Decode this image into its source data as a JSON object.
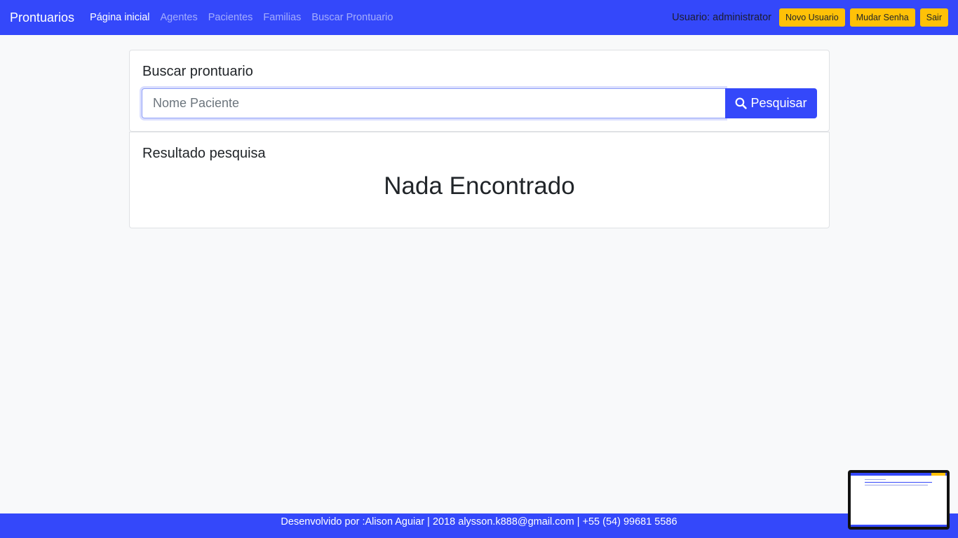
{
  "navbar": {
    "brand": "Prontuarios",
    "links": [
      {
        "label": "Página inicial",
        "active": true
      },
      {
        "label": "Agentes",
        "active": false
      },
      {
        "label": "Pacientes",
        "active": false
      },
      {
        "label": "Familias",
        "active": false
      },
      {
        "label": "Buscar Prontuario",
        "active": false
      }
    ],
    "user_label": "Usuario: administrator",
    "buttons": {
      "new_user": "Novo Usuario",
      "change_password": "Mudar Senha",
      "logout": "Sair"
    }
  },
  "search": {
    "title": "Buscar prontuario",
    "placeholder": "Nome Paciente",
    "value": "",
    "button_label": "Pesquisar",
    "button_icon": "search-icon"
  },
  "results": {
    "title": "Resultado pesquisa",
    "empty_message": "Nada Encontrado"
  },
  "footer": {
    "text": "Desenvolvido por :Alison Aguiar | 2018 alysson.k888@gmail.com | +55 (54) 99681 5586"
  },
  "colors": {
    "primary": "#3448fa",
    "warning": "#ffc107",
    "background": "#f8f9fa"
  }
}
